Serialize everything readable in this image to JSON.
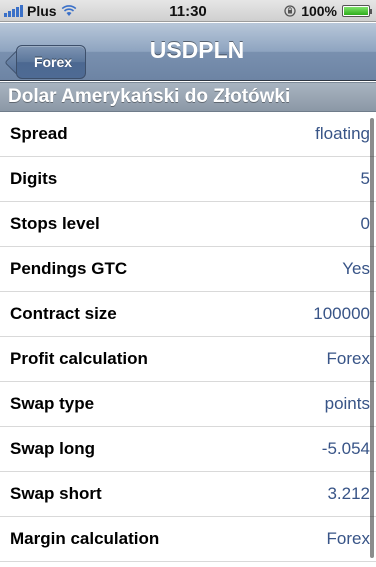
{
  "status_bar": {
    "carrier": "Plus",
    "time": "11:30",
    "battery": "100%",
    "icons": [
      "signal-bars-icon",
      "wifi-icon",
      "orientation-lock-icon",
      "battery-icon"
    ]
  },
  "nav": {
    "back_label": "Forex",
    "title": "USDPLN"
  },
  "section": {
    "header": "Dolar Amerykański do Złotówki"
  },
  "rows": [
    {
      "label": "Spread",
      "value": "floating"
    },
    {
      "label": "Digits",
      "value": "5"
    },
    {
      "label": "Stops level",
      "value": "0"
    },
    {
      "label": "Pendings GTC",
      "value": "Yes"
    },
    {
      "label": "Contract size",
      "value": "100000"
    },
    {
      "label": "Profit calculation",
      "value": "Forex"
    },
    {
      "label": "Swap type",
      "value": "points"
    },
    {
      "label": "Swap long",
      "value": "-5.054"
    },
    {
      "label": "Swap short",
      "value": "3.212"
    },
    {
      "label": "Margin calculation",
      "value": "Forex"
    }
  ],
  "colors": {
    "nav_bar": "#7990af",
    "value_text": "#385487",
    "section_header": "#98a5b2"
  }
}
